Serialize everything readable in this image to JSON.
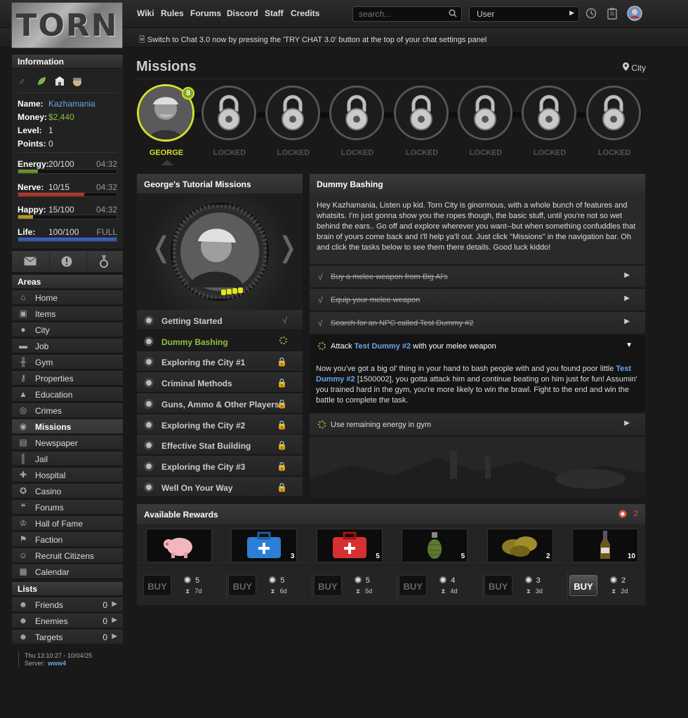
{
  "header": {
    "logo_text": "TORN",
    "nav": [
      "Wiki",
      "Rules",
      "Forums",
      "Discord",
      "Staff",
      "Credits"
    ],
    "search_placeholder": "search...",
    "user_select": "User",
    "notice": "Switch to Chat 3.0 now by pressing the 'TRY CHAT 3.0' button at the top of your chat settings panel"
  },
  "sidebar": {
    "info_title": "Information",
    "name_label": "Name:",
    "name": "Kazhamania",
    "money_label": "Money:",
    "money": "$2,440",
    "level_label": "Level:",
    "level": "1",
    "points_label": "Points:",
    "points": "0",
    "bars": [
      {
        "label": "Energy:",
        "value": "20/100",
        "timer": "04:32",
        "fill": 0.2,
        "color": "#6c9e2a"
      },
      {
        "label": "Nerve:",
        "value": "10/15",
        "timer": "04:32",
        "fill": 0.67,
        "color": "#c0392b"
      },
      {
        "label": "Happy:",
        "value": "15/100",
        "timer": "04:32",
        "fill": 0.15,
        "color": "#c9a21b"
      },
      {
        "label": "Life:",
        "value": "100/100",
        "timer": "FULL",
        "fill": 1.0,
        "color": "#3b64c9"
      }
    ],
    "areas_title": "Areas",
    "areas": [
      "Home",
      "Items",
      "City",
      "Job",
      "Gym",
      "Properties",
      "Education",
      "Crimes",
      "Missions",
      "Newspaper",
      "Jail",
      "Hospital",
      "Casino",
      "Forums",
      "Hall of Fame",
      "Faction",
      "Recruit Citizens",
      "Calendar"
    ],
    "active_area": "Missions",
    "lists_title": "Lists",
    "lists": [
      {
        "label": "Friends",
        "count": "0"
      },
      {
        "label": "Enemies",
        "count": "0"
      },
      {
        "label": "Targets",
        "count": "0"
      }
    ],
    "server_time": "Thu 13:10:27 - 10/04/25",
    "server_label": "Server:",
    "server": "www4"
  },
  "main": {
    "title": "Missions",
    "location": "City",
    "givers": [
      {
        "name": "GEORGE",
        "badge": "8"
      },
      {
        "name": "LOCKED"
      },
      {
        "name": "LOCKED"
      },
      {
        "name": "LOCKED"
      },
      {
        "name": "LOCKED"
      },
      {
        "name": "LOCKED"
      },
      {
        "name": "LOCKED"
      },
      {
        "name": "LOCKED"
      }
    ],
    "tutorial_title": "George's Tutorial Missions",
    "missions": [
      {
        "label": "Getting Started",
        "status": "done"
      },
      {
        "label": "Dummy Bashing",
        "status": "active"
      },
      {
        "label": "Exploring the City #1",
        "status": "locked"
      },
      {
        "label": "Criminal Methods",
        "status": "locked"
      },
      {
        "label": "Guns, Ammo & Other Players",
        "status": "locked"
      },
      {
        "label": "Exploring the City #2",
        "status": "locked"
      },
      {
        "label": "Effective Stat Building",
        "status": "locked"
      },
      {
        "label": "Exploring the City #3",
        "status": "locked"
      },
      {
        "label": "Well On Your Way",
        "status": "locked"
      }
    ],
    "detail_title": "Dummy Bashing",
    "detail_text": "Hey Kazhamania, Listen up kid. Torn City is ginormous, with a whole bunch of features and whatsits. I'm just gonna show you the ropes though, the basic stuff, until you're not so wet behind the ears.. Go off and explore wherever you want--but when something confuddles that brain of yours come back and I'll help ya'll out. Just click \"Missions\" in the navigation bar. Oh and click the tasks below to see them there details. Good luck kiddo!",
    "tasks_done": [
      "Buy a melee weapon from Big Al's",
      "Equip your melee weapon",
      "Search for an NPC called Test Dummy #2"
    ],
    "task_active_pre": "Attack ",
    "task_active_link": "Test Dummy #2",
    "task_active_post": " with your melee weapon",
    "task_active_desc_1": "Now you've got a big ol' thing in your hand to bash people with and you found poor little ",
    "task_active_desc_link": "Test Dummy #2",
    "task_active_desc_2": " [1500002], you gotta attack him and continue beating on him just for fun! Assumin' you trained hard in the gym, you're more likely to win the brawl. Fight to the end and win the battle to complete the task.",
    "task_last": "Use remaining energy in gym",
    "rewards_title": "Available Rewards",
    "rewards_count": "2",
    "buy_label": "BUY",
    "rewards": [
      {
        "icon": "piggy-bank-icon",
        "qty": "",
        "cost": "5",
        "time": "7d",
        "enabled": false
      },
      {
        "icon": "blue-medkit-icon",
        "qty": "3",
        "cost": "5",
        "time": "6d",
        "enabled": false
      },
      {
        "icon": "red-medkit-icon",
        "qty": "5",
        "cost": "5",
        "time": "5d",
        "enabled": false
      },
      {
        "icon": "grenade-icon",
        "qty": "5",
        "cost": "4",
        "time": "4d",
        "enabled": false
      },
      {
        "icon": "cannabis-icon",
        "qty": "2",
        "cost": "3",
        "time": "3d",
        "enabled": false
      },
      {
        "icon": "bottle-icon",
        "qty": "10",
        "cost": "2",
        "time": "2d",
        "enabled": true
      }
    ]
  }
}
